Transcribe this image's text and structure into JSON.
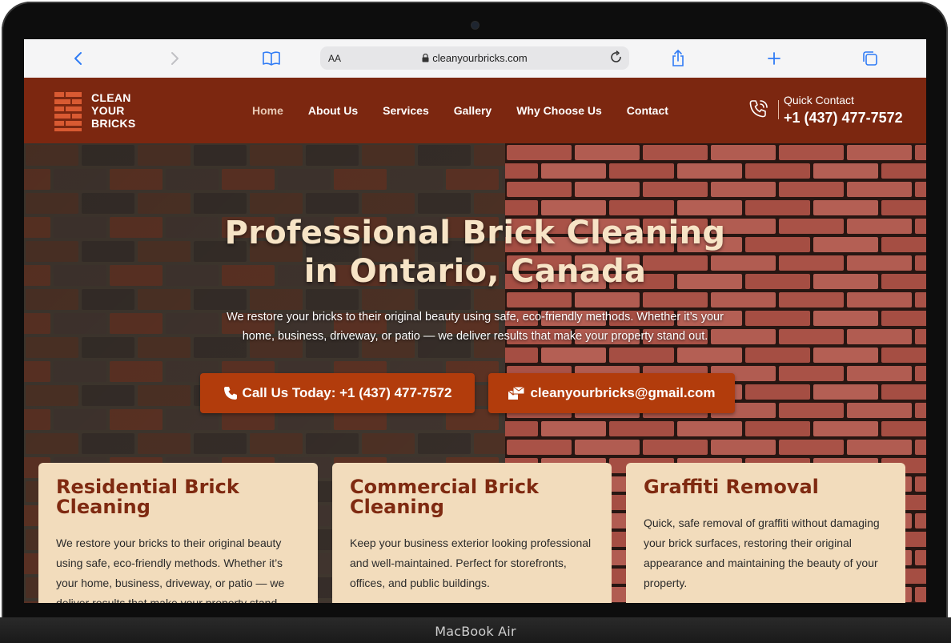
{
  "device": {
    "label": "MacBook Air"
  },
  "browser": {
    "text_size_label": "AA",
    "url": "cleanyourbricks.com"
  },
  "site": {
    "logo_lines": [
      "CLEAN",
      "YOUR",
      "BRICKS"
    ],
    "nav": [
      {
        "label": "Home",
        "active": true
      },
      {
        "label": "About Us"
      },
      {
        "label": "Services"
      },
      {
        "label": "Gallery"
      },
      {
        "label": "Why Choose Us"
      },
      {
        "label": "Contact"
      }
    ],
    "quick_contact": {
      "label": "Quick Contact",
      "phone": "+1 (437) 477-7572"
    },
    "colors": {
      "header": "#7c2710",
      "button": "#b23c0c",
      "card": "#f2dcbc",
      "title": "#f7e4c6"
    }
  },
  "hero": {
    "title_line1": "Professional Brick Cleaning",
    "title_line2": "in Ontario, Canada",
    "subtitle_line1": "We restore your bricks to their original beauty using safe, eco-friendly methods. Whether it’s your",
    "subtitle_line2": "home, business, driveway, or patio — we deliver results that make your property stand out.",
    "call_button": "Call Us Today: +1 (437) 477-7572",
    "email_button": "cleanyourbricks@gmail.com"
  },
  "cards": [
    {
      "title": "Residential Brick Cleaning",
      "text": "We restore your bricks to their original beauty using safe, eco-friendly methods. Whether it’s your home, business, driveway, or patio — we deliver results that make your property stand"
    },
    {
      "title": "Commercial Brick Cleaning",
      "text": "Keep your business exterior looking professional and well-maintained. Perfect for storefronts, offices, and public buildings."
    },
    {
      "title": "Graffiti Removal",
      "text": "Quick, safe removal of graffiti without damaging your brick surfaces, restoring their original appearance and maintaining the beauty of your property."
    }
  ]
}
